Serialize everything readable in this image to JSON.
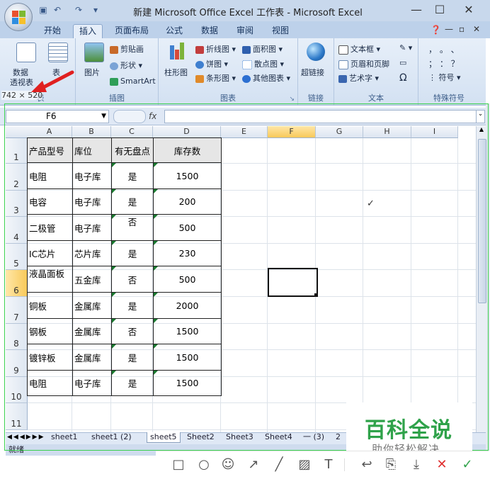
{
  "window": {
    "title": "新建 Microsoft Office Excel 工作表 - Microsoft Excel",
    "controls": [
      "—",
      "☐",
      "✕"
    ]
  },
  "ribbon": {
    "tabs": [
      "开始",
      "插入",
      "页面布局",
      "公式",
      "数据",
      "审阅",
      "视图"
    ],
    "active_tab": "插入",
    "groups": {
      "table": {
        "name": "表",
        "pivot_label_1": "数据",
        "pivot_label_2": "透视表",
        "table_label": "表"
      },
      "illustrations": {
        "name": "插图",
        "picture": "图片",
        "clipart": "剪贴画",
        "shapes": "形状",
        "smartart": "SmartArt"
      },
      "charts": {
        "name": "图表",
        "column": "柱形图",
        "line": "折线图",
        "pie": "饼图",
        "bar": "条形图",
        "area": "面积图",
        "scatter": "散点图",
        "other": "其他图表"
      },
      "links": {
        "name": "链接",
        "hyperlink": "超链接"
      },
      "text": {
        "name": "文本",
        "textbox": "文本框",
        "header_footer": "页眉和页脚",
        "wordart": "艺术字",
        "omega": "Ω"
      },
      "symbols": {
        "name": "特殊符号",
        "symbol": "符号",
        "marks_row1": "， 。 、",
        "marks_row2": "； ： ？"
      }
    }
  },
  "overlay": {
    "size_label": "742 × 520"
  },
  "formula_bar": {
    "name_box": "F6",
    "fx": "fx",
    "formula": ""
  },
  "columns": [
    "A",
    "B",
    "C",
    "D",
    "E",
    "F",
    "G",
    "H",
    "I"
  ],
  "selected_column": "F",
  "selected_row": "6",
  "rows": [
    "1",
    "2",
    "3",
    "4",
    "5",
    "6",
    "7",
    "8",
    "9",
    "10",
    "11"
  ],
  "table": {
    "headers": [
      "产品型号",
      "库位",
      "有无盘点",
      "库存数"
    ],
    "rows": [
      [
        "电阻",
        "电子库",
        "是",
        "1500"
      ],
      [
        "电容",
        "电子库",
        "是",
        "200"
      ],
      [
        "二极管",
        "电子库",
        "否",
        "500"
      ],
      [
        "IC芯片",
        "芯片库",
        "是",
        "230"
      ],
      [
        "液晶面板",
        "五金库",
        "否",
        "500"
      ],
      [
        "铜板",
        "金属库",
        "是",
        "2000"
      ],
      [
        "钢板",
        "金属库",
        "否",
        "1500"
      ],
      [
        "镀锌板",
        "金属库",
        "是",
        "1500"
      ],
      [
        "电阻",
        "电子库",
        "是",
        "1500"
      ]
    ]
  },
  "sheets": [
    "sheet1",
    "sheet1 (2)",
    "sheet5",
    "Sheet2",
    "Sheet3",
    "Sheet4",
    "一 (3)",
    "2"
  ],
  "active_sheet": "sheet5",
  "status": {
    "ready": "就绪"
  },
  "watermark": {
    "title": "百科全说",
    "subtitle": "助你轻松解决"
  },
  "annotation_tools": [
    "rectangle",
    "ellipse",
    "emoji",
    "arrow",
    "pen",
    "mosaic",
    "text",
    "undo",
    "save",
    "download",
    "cancel",
    "confirm"
  ],
  "colors": {
    "accent_green": "#2fa24a",
    "ribbon_blue": "#bdd1ea",
    "selection_orange": "#f8c95a",
    "arrow_red": "#e02020"
  }
}
